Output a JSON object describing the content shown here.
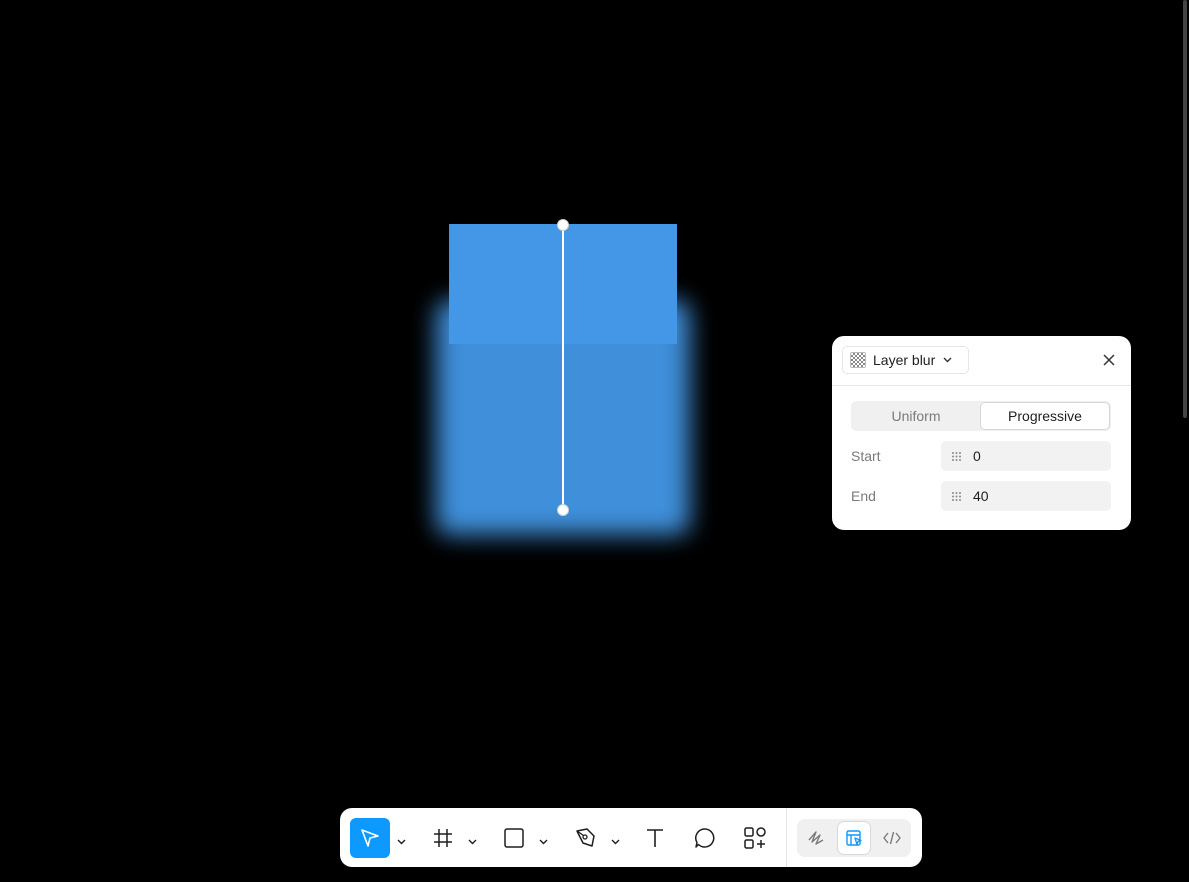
{
  "canvas": {
    "shape_color": "#4397e6",
    "background": "#000000"
  },
  "effect_panel": {
    "effect_type": "Layer blur",
    "icons": {
      "effect": "checkerboard-icon",
      "dropdown": "chevron-down-icon",
      "close": "close-icon"
    },
    "modes": [
      "Uniform",
      "Progressive"
    ],
    "selected_mode": "Progressive",
    "start_label": "Start",
    "start_value": "0",
    "end_label": "End",
    "end_value": "40"
  },
  "toolbar": {
    "accent": "#0d99ff",
    "tools": [
      "move-tool",
      "frame-tool",
      "rectangle-tool",
      "pen-tool",
      "text-tool",
      "comment-tool",
      "actions-tool"
    ],
    "active_tool": "move-tool",
    "modes": [
      "draw-mode",
      "design-mode",
      "dev-mode"
    ],
    "active_mode": "design-mode"
  }
}
